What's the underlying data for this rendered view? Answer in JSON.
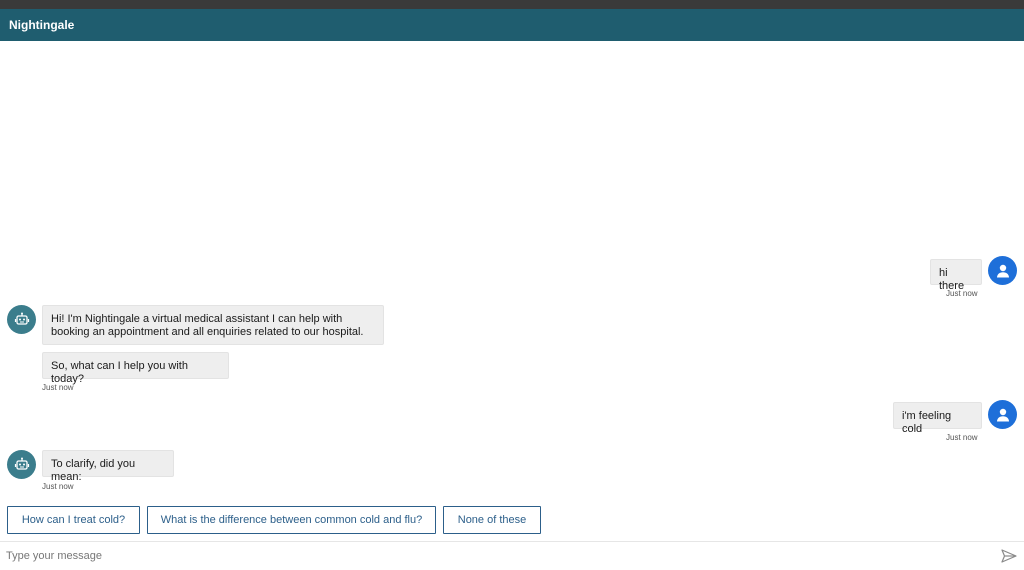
{
  "app": {
    "title": "Nightingale"
  },
  "messages": [
    {
      "sender": "user",
      "text": "hi there",
      "timestamp": "Just now"
    },
    {
      "sender": "bot",
      "text": "Hi! I'm Nightingale a virtual medical assistant I can help with booking an appointment and all enquiries related to our hospital."
    },
    {
      "sender": "bot",
      "text": "So, what can I help you with today?",
      "timestamp": "Just now"
    },
    {
      "sender": "user",
      "text": "i'm feeling cold",
      "timestamp": "Just now"
    },
    {
      "sender": "bot",
      "text": "To clarify, did you mean:",
      "timestamp": "Just now"
    }
  ],
  "suggestions": [
    {
      "label": "How can I treat cold?"
    },
    {
      "label": "What is the difference between common cold and flu?"
    },
    {
      "label": "None of these"
    }
  ],
  "composer": {
    "placeholder": "Type your message"
  },
  "icons": {
    "user_avatar": "user-icon",
    "bot_avatar": "robot-icon",
    "send": "send-icon"
  },
  "colors": {
    "header": "#1f5d6f",
    "user_avatar": "#1e6fd9",
    "bot_avatar": "#3b7d8c",
    "suggestion_border": "#2c5f8a"
  }
}
